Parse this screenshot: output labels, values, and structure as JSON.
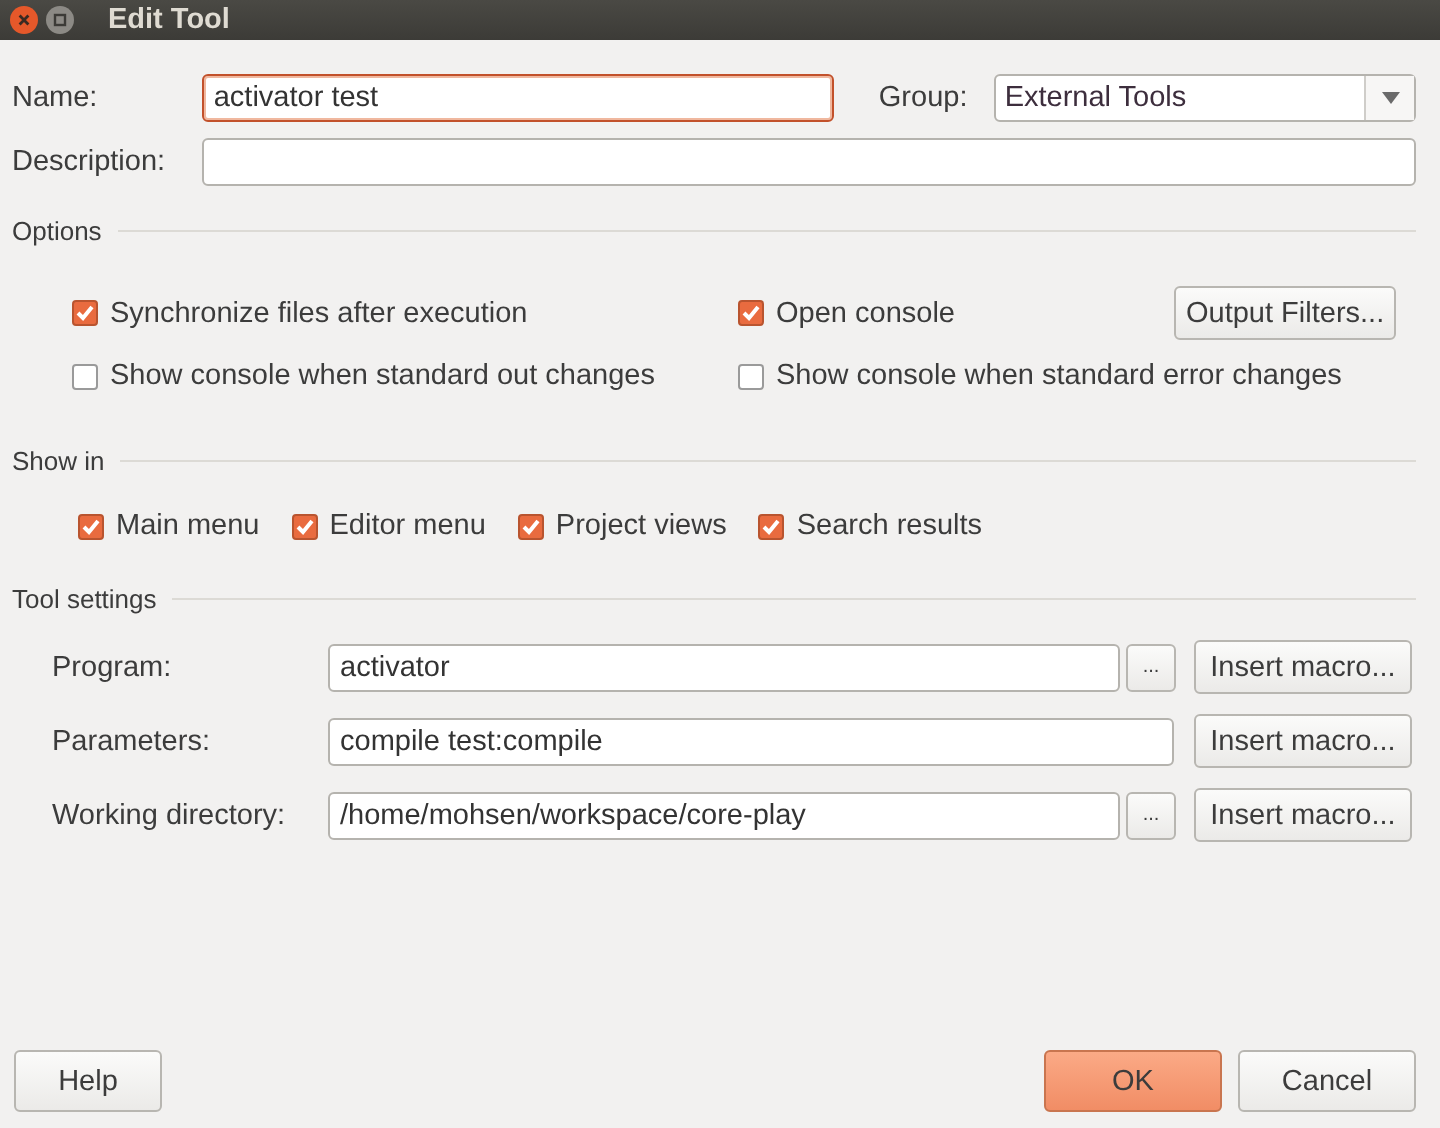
{
  "window": {
    "title": "Edit Tool"
  },
  "name": {
    "label": "Name:",
    "value": "activator test",
    "focused": true
  },
  "group": {
    "label": "Group:",
    "value": "External Tools"
  },
  "description": {
    "label": "Description:"
  },
  "options": {
    "title": "Options",
    "checks": [
      {
        "label": "Synchronize files after execution",
        "checked": true
      },
      {
        "label": "Open console",
        "checked": true
      },
      {
        "label": "Show console when standard out changes",
        "checked": false
      },
      {
        "label": "Show console when standard error changes",
        "checked": false
      }
    ],
    "button": "Output Filters..."
  },
  "show_in": {
    "title": "Show in",
    "checks": [
      {
        "label": "Main menu",
        "checked": true
      },
      {
        "label": "Editor menu",
        "checked": true
      },
      {
        "label": "Project views",
        "checked": true
      },
      {
        "label": "Search results",
        "checked": true
      }
    ]
  },
  "tool_settings": {
    "title": "Tool settings",
    "rows": [
      {
        "label": "Program:",
        "value": "activator",
        "browse_button": "...",
        "macro_button": "Insert macro..."
      },
      {
        "label": "Parameters:",
        "value": "compile test:compile",
        "macro_button": "Insert macro..."
      },
      {
        "label": "Working directory:",
        "value": "/home/mohsen/workspace/core-play",
        "browse_button": "...",
        "macro_button": "Insert macro..."
      }
    ]
  },
  "buttons": [
    {
      "label": "Help",
      "default": false
    },
    {
      "label": "OK",
      "default": true
    },
    {
      "label": "Cancel",
      "default": false
    }
  ]
}
